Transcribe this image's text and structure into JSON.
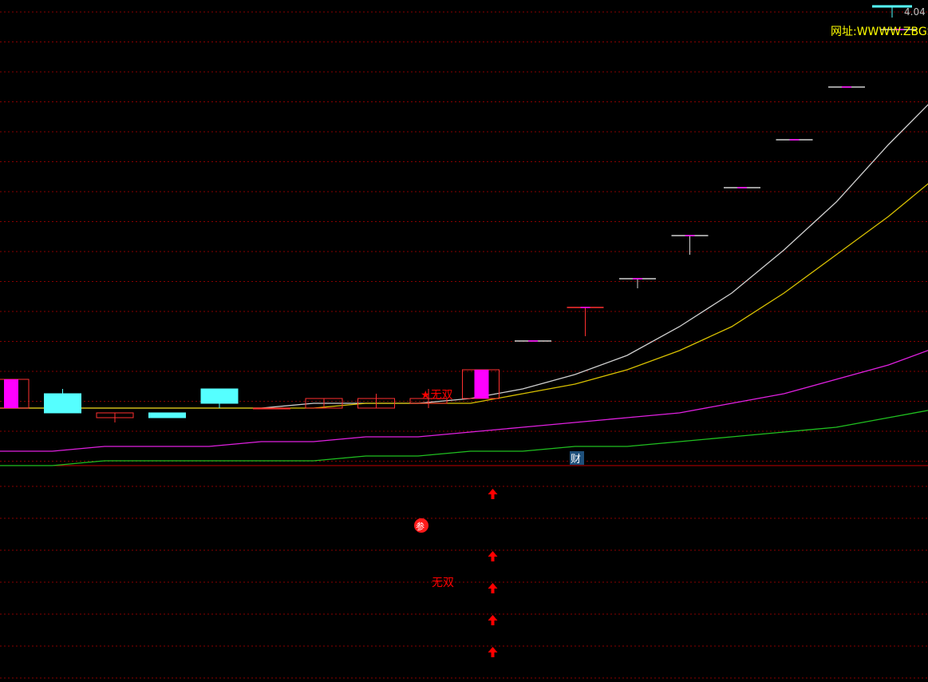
{
  "colors": {
    "background": "#000000",
    "grid": "#8a0000",
    "divider": "#c00000",
    "candle_up": "#ff3030",
    "candle_down_fill": "#55ffff",
    "candle_highlight": "#ff00ff",
    "ma_white": "#d0d0d0",
    "ma_yellow": "#d8c000",
    "ma_magenta": "#e020e0",
    "ma_green": "#20c020",
    "signal_red": "#ff0000",
    "website_text": "#ffff00",
    "price_text": "#c0c0c0",
    "cai_bg": "#1e4f7a",
    "cai_text": "#ffffff"
  },
  "header": {
    "price_label": "4.04",
    "website_label": "网址:WWWW.ZBGS"
  },
  "chart_data": {
    "type": "candlestick",
    "note_x": "candle index",
    "candles": [
      {
        "open": 3.34,
        "close": 3.4,
        "high": 3.4,
        "low": 3.34,
        "style": "highlight"
      },
      {
        "open": 3.33,
        "close": 3.37,
        "high": 3.38,
        "low": 3.33,
        "style": "down"
      },
      {
        "open": 3.33,
        "close": 3.32,
        "high": 3.33,
        "low": 3.31,
        "style": "up"
      },
      {
        "open": 3.33,
        "close": 3.32,
        "high": 3.33,
        "low": 3.32,
        "style": "down"
      },
      {
        "open": 3.35,
        "close": 3.38,
        "high": 3.38,
        "low": 3.34,
        "style": "down"
      },
      {
        "open": 3.34,
        "close": 3.34,
        "high": 3.34,
        "low": 3.34,
        "style": "up"
      },
      {
        "open": 3.34,
        "close": 3.36,
        "high": 3.36,
        "low": 3.34,
        "style": "up"
      },
      {
        "open": 3.34,
        "close": 3.36,
        "high": 3.37,
        "low": 3.34,
        "style": "up"
      },
      {
        "open": 3.35,
        "close": 3.36,
        "high": 3.38,
        "low": 3.34,
        "style": "up"
      },
      {
        "open": 3.36,
        "close": 3.42,
        "high": 3.42,
        "low": 3.36,
        "style": "highlight"
      },
      {
        "open": 3.48,
        "close": 3.48,
        "high": 3.48,
        "low": 3.48,
        "style": "flat"
      },
      {
        "open": 3.55,
        "close": 3.55,
        "high": 3.55,
        "low": 3.49,
        "style": "flat_red"
      },
      {
        "open": 3.61,
        "close": 3.61,
        "high": 3.61,
        "low": 3.59,
        "style": "flat"
      },
      {
        "open": 3.7,
        "close": 3.7,
        "high": 3.7,
        "low": 3.66,
        "style": "flat"
      },
      {
        "open": 3.8,
        "close": 3.8,
        "high": 3.8,
        "low": 3.8,
        "style": "flat"
      },
      {
        "open": 3.9,
        "close": 3.9,
        "high": 3.9,
        "low": 3.9,
        "style": "flat"
      },
      {
        "open": 4.01,
        "close": 4.01,
        "high": 4.01,
        "low": 4.01,
        "style": "flat"
      },
      {
        "open": 4.13,
        "close": 4.13,
        "high": 4.13,
        "low": 4.13,
        "style": "flat"
      },
      {
        "open": 4.25,
        "close": 4.25,
        "high": 4.25,
        "low": 4.25,
        "style": "cyan_top"
      }
    ],
    "series": [
      {
        "color_key": "ma_white",
        "values": [
          3.34,
          3.34,
          3.34,
          3.34,
          3.34,
          3.34,
          3.35,
          3.35,
          3.35,
          3.36,
          3.38,
          3.41,
          3.45,
          3.51,
          3.58,
          3.67,
          3.77,
          3.89,
          4.0,
          4.06
        ]
      },
      {
        "color_key": "ma_yellow",
        "values": [
          3.34,
          3.34,
          3.34,
          3.34,
          3.34,
          3.34,
          3.34,
          3.35,
          3.35,
          3.35,
          3.37,
          3.39,
          3.42,
          3.46,
          3.51,
          3.58,
          3.66,
          3.74,
          3.83,
          3.88
        ]
      },
      {
        "color_key": "ma_magenta",
        "values": [
          3.25,
          3.25,
          3.26,
          3.26,
          3.26,
          3.27,
          3.27,
          3.28,
          3.28,
          3.29,
          3.3,
          3.31,
          3.32,
          3.33,
          3.35,
          3.37,
          3.4,
          3.43,
          3.47,
          3.5
        ]
      },
      {
        "color_key": "ma_green",
        "values": [
          3.22,
          3.22,
          3.23,
          3.23,
          3.23,
          3.23,
          3.23,
          3.24,
          3.24,
          3.25,
          3.25,
          3.26,
          3.26,
          3.27,
          3.28,
          3.29,
          3.3,
          3.32,
          3.34,
          3.36
        ]
      }
    ],
    "annotations": {
      "main_signal": "★无双",
      "cai_badge": "财",
      "lower_signal": "无双",
      "can_badge": "参"
    },
    "signal_candle_index": 9,
    "cai_candle_index": 11,
    "lower_arrows": 5
  }
}
